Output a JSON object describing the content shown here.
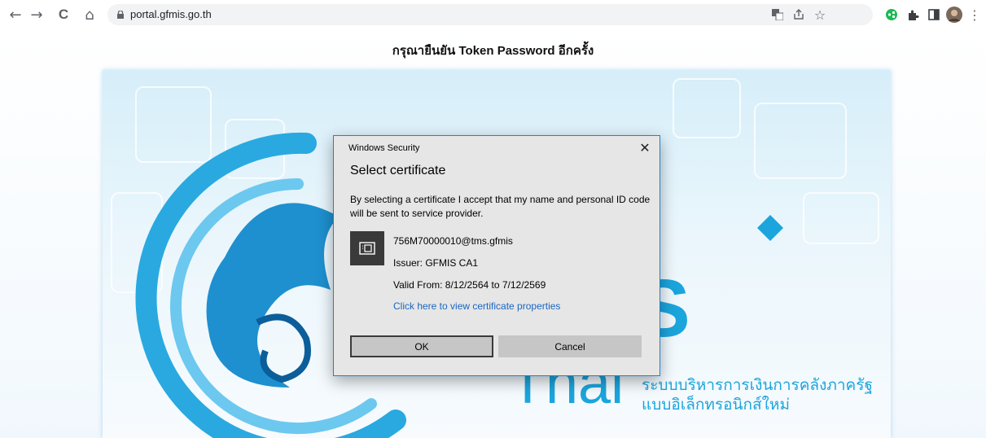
{
  "browser": {
    "url": "portal.gfmis.go.th",
    "nav": {
      "back": "←",
      "forward": "→",
      "reload": "C",
      "home": "⌂"
    },
    "toolbar_icons": [
      "translate-icon",
      "share-icon",
      "bookmark-star-icon",
      "extension-green-icon",
      "extensions-puzzle-icon",
      "side-panel-icon",
      "profile-avatar",
      "menu-icon"
    ],
    "glyphs": {
      "star": "☆",
      "menu": "⋮"
    }
  },
  "page": {
    "heading": "กรุณายืนยัน Token Password อีกครั้ง"
  },
  "banner": {
    "logo_main": "MIS",
    "logo_sub": "Thai",
    "thai_line1": "ระบบบริหารการเงินการคลังภาครัฐ",
    "thai_line2": "แบบอิเล็กทรอนิกส์ใหม่",
    "accent_color": "#1ba5dc"
  },
  "dialog": {
    "window_title": "Windows Security",
    "close_glyph": "✕",
    "heading": "Select certificate",
    "message": "By selecting a certificate I accept that my name and personal ID code will be sent to service provider.",
    "certificate": {
      "subject": "756M70000010@tms.gfmis",
      "issuer": "Issuer: GFMIS CA1",
      "valid": "Valid From: 8/12/2564 to 7/12/2569",
      "properties_link": "Click here to view certificate properties"
    },
    "ok_label": "OK",
    "cancel_label": "Cancel"
  }
}
